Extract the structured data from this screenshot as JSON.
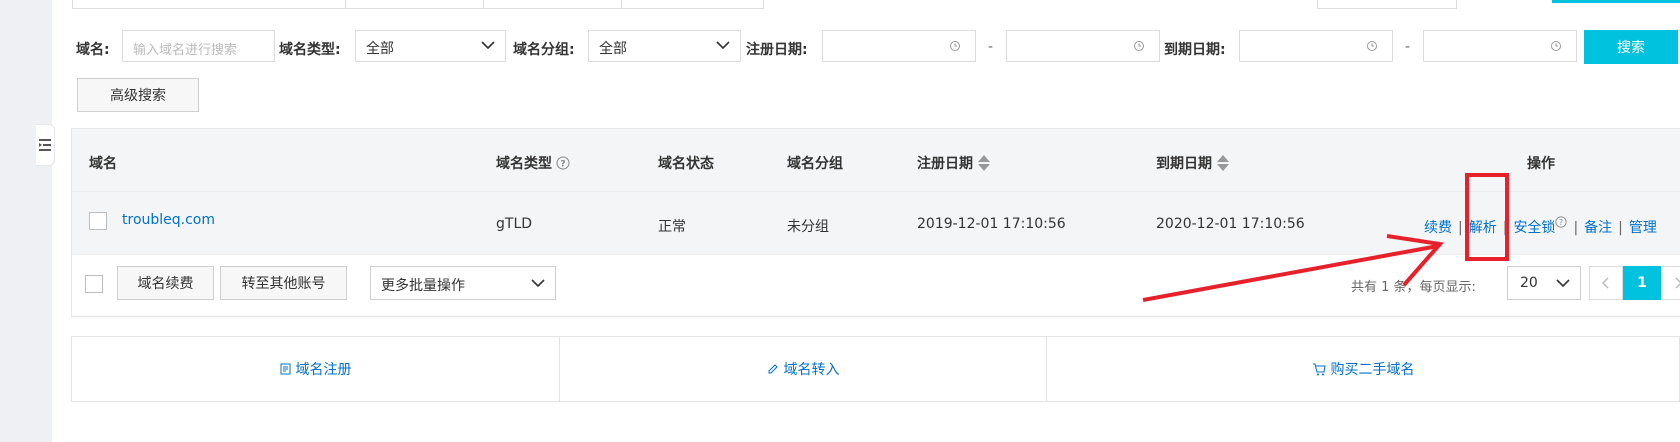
{
  "filters": {
    "domain_label": "域名:",
    "domain_placeholder": "输入域名进行搜索",
    "type_label": "域名类型:",
    "type_value": "全部",
    "group_label": "域名分组:",
    "group_value": "全部",
    "reg_label": "注册日期:",
    "range_sep": "-",
    "exp_label": "到期日期:",
    "search_label": "搜索",
    "advanced_label": "高级搜索"
  },
  "table": {
    "headers": {
      "domain": "域名",
      "type": "域名类型",
      "status": "域名状态",
      "group": "域名分组",
      "reg_date": "注册日期",
      "exp_date": "到期日期",
      "actions": "操作"
    },
    "rows": [
      {
        "domain": "troubleq.com",
        "type": "gTLD",
        "status": "正常",
        "group": "未分组",
        "reg_date": "2019-12-01 17:10:56",
        "exp_date": "2020-12-01 17:10:56",
        "actions": [
          "续费",
          "解析",
          "安全锁",
          "备注",
          "管理"
        ]
      }
    ]
  },
  "footer": {
    "renew_label": "域名续费",
    "transfer_label": "转至其他账号",
    "batch_label": "更多批量操作",
    "total_text": "共有 1 条，每页显示:",
    "page_size": "20",
    "current_page": "1"
  },
  "quick_links": {
    "register": "域名注册",
    "transfer_in": "域名转入",
    "buy_second_hand": "购买二手域名"
  },
  "annotation": {
    "color": "#e8202a"
  },
  "colors": {
    "accent": "#00c1de",
    "link": "#0070cc"
  }
}
